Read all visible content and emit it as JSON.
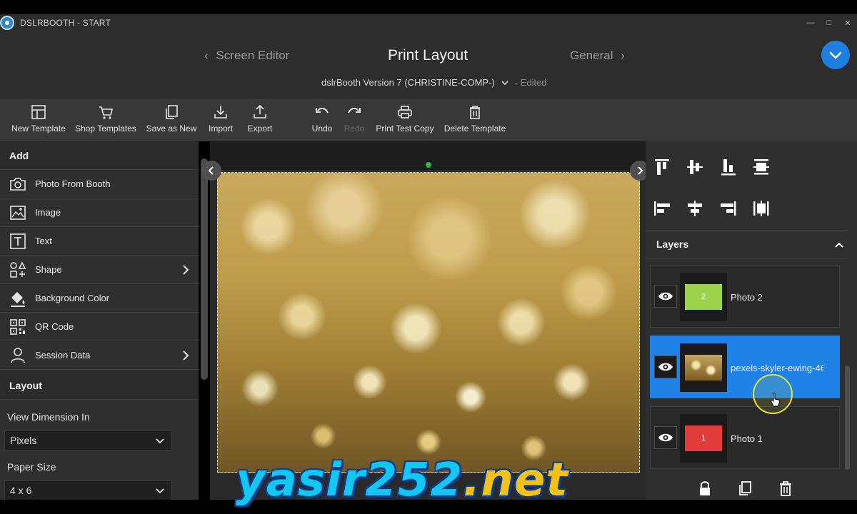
{
  "app": {
    "title": "DSLRBOOTH - START"
  },
  "header": {
    "prev_tab": "Screen Editor",
    "current_tab": "Print Layout",
    "next_tab": "General",
    "template_name": "dslrBooth Version 7 (CHRISTINE-COMP-)",
    "template_status": "- Edited",
    "accent_color": "#1f7fe0"
  },
  "toolbar": {
    "items": [
      {
        "label": "New Template",
        "icon": "template-icon"
      },
      {
        "label": "Shop Templates",
        "icon": "cart-icon"
      },
      {
        "label": "Save as New",
        "icon": "copy-icon"
      },
      {
        "label": "Import",
        "icon": "import-icon"
      },
      {
        "label": "Export",
        "icon": "export-icon"
      },
      {
        "label": "Undo",
        "icon": "undo-icon"
      },
      {
        "label": "Redo",
        "icon": "redo-icon",
        "disabled": true
      },
      {
        "label": "Print Test Copy",
        "icon": "printer-icon"
      },
      {
        "label": "Delete Template",
        "icon": "trash-icon"
      }
    ]
  },
  "left": {
    "add_heading": "Add",
    "add_items": [
      {
        "label": "Photo From Booth",
        "icon": "camera-icon"
      },
      {
        "label": "Image",
        "icon": "image-icon"
      },
      {
        "label": "Text",
        "icon": "text-icon"
      },
      {
        "label": "Shape",
        "icon": "shape-icon"
      },
      {
        "label": "Background Color",
        "icon": "paint-bucket-icon"
      },
      {
        "label": "QR Code",
        "icon": "qr-code-icon"
      },
      {
        "label": "Session Data",
        "icon": "user-icon"
      }
    ],
    "layout_heading": "Layout",
    "view_dimension_label": "View Dimension In",
    "view_dimension_value": "Pixels",
    "paper_size_label": "Paper Size",
    "paper_size_value": "4 x 6"
  },
  "right": {
    "layers_heading": "Layers",
    "layers": [
      {
        "name": "Photo 2",
        "badge": "2",
        "color": "#9bd34a"
      },
      {
        "name": "pexels-skyler-ewing-46",
        "badge": "",
        "color": "#b89a4d",
        "selected": true
      },
      {
        "name": "Photo 1",
        "badge": "1",
        "color": "#e23d3d"
      }
    ]
  },
  "watermark": {
    "main": "yasir252",
    "tld": ".net"
  }
}
